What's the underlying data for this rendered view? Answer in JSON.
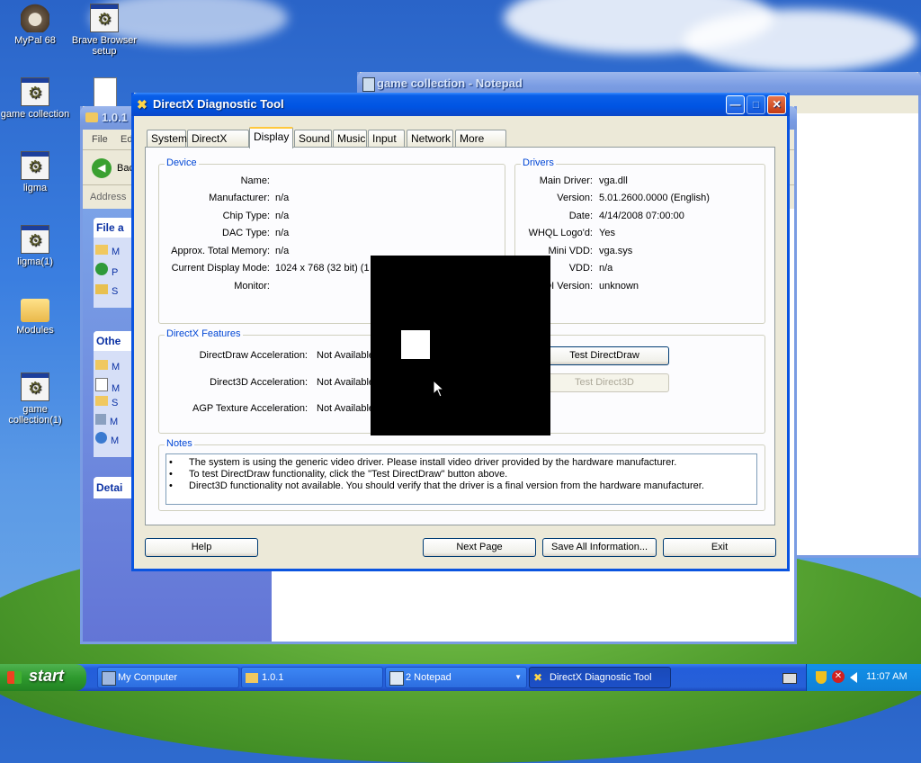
{
  "desktop_icons": [
    {
      "label": "MyPal 68",
      "icon": "raccoon-icon"
    },
    {
      "label": "Brave Browser setup",
      "icon": "installer-icon"
    },
    {
      "label": "game collection",
      "icon": "program-icon"
    },
    {
      "label": "ligma",
      "icon": "program-icon"
    },
    {
      "label": "ligma(1)",
      "icon": "program-icon"
    },
    {
      "label": "Modules",
      "icon": "folder-icon"
    },
    {
      "label": "game collection(1)",
      "icon": "program-icon"
    }
  ],
  "notepad": {
    "title": "game collection - Notepad"
  },
  "explorer": {
    "title": "1.0.1",
    "menu": [
      "File",
      "Ed"
    ],
    "back_label": "Bac",
    "address_label": "Address",
    "file_tasks_header": "File a",
    "file_tasks": [
      "M",
      "P",
      "S"
    ],
    "other_places_header": "Othe",
    "other_places": [
      "M",
      "M",
      "S",
      "M",
      "M"
    ],
    "details_header": "Detai"
  },
  "dxdiag": {
    "title": "DirectX Diagnostic Tool",
    "tabs": [
      "System",
      "DirectX Files",
      "Display",
      "Sound",
      "Music",
      "Input",
      "Network",
      "More Help"
    ],
    "active_tab": "Display",
    "device": {
      "title": "Device",
      "fields": [
        {
          "label": "Name:",
          "value": ""
        },
        {
          "label": "Manufacturer:",
          "value": "n/a"
        },
        {
          "label": "Chip Type:",
          "value": "n/a"
        },
        {
          "label": "DAC Type:",
          "value": "n/a"
        },
        {
          "label": "Approx. Total Memory:",
          "value": "n/a"
        },
        {
          "label": "Current Display Mode:",
          "value": "1024 x 768 (32 bit) (1"
        },
        {
          "label": "Monitor:",
          "value": ""
        }
      ]
    },
    "drivers": {
      "title": "Drivers",
      "fields": [
        {
          "label": "Main Driver:",
          "value": "vga.dll"
        },
        {
          "label": "Version:",
          "value": "5.01.2600.0000 (English)"
        },
        {
          "label": "Date:",
          "value": "4/14/2008 07:00:00"
        },
        {
          "label": "WHQL Logo'd:",
          "value": "Yes"
        },
        {
          "label": "Mini VDD:",
          "value": "vga.sys"
        },
        {
          "label": "VDD:",
          "value": "n/a"
        },
        {
          "label": "DDI Version:",
          "value": "unknown"
        }
      ]
    },
    "features": {
      "title": "DirectX Features",
      "rows": [
        {
          "label": "DirectDraw Acceleration:",
          "value": "Not Available"
        },
        {
          "label": "Direct3D Acceleration:",
          "value": "Not Available"
        },
        {
          "label": "AGP Texture Acceleration:",
          "value": "Not Available"
        }
      ],
      "test_directdraw": "Test DirectDraw",
      "test_direct3d": "Test Direct3D"
    },
    "notes": {
      "title": "Notes",
      "items": [
        "The system is using the generic video driver.  Please install video driver provided by the hardware manufacturer.",
        "To test DirectDraw functionality, click the \"Test DirectDraw\" button above.",
        "Direct3D functionality not available.  You should verify that the driver is a final version from the hardware manufacturer."
      ]
    },
    "buttons": {
      "help": "Help",
      "next_page": "Next Page",
      "save_all": "Save All Information...",
      "exit": "Exit"
    }
  },
  "taskbar": {
    "start": "start",
    "items": [
      {
        "label": "My Computer",
        "icon": "computer-icon"
      },
      {
        "label": "1.0.1",
        "icon": "folder-icon"
      },
      {
        "label": "2 Notepad",
        "icon": "notepad-icon"
      },
      {
        "label": "DirectX Diagnostic Tool",
        "icon": "directx-icon"
      }
    ],
    "clock": "11:07 AM"
  }
}
